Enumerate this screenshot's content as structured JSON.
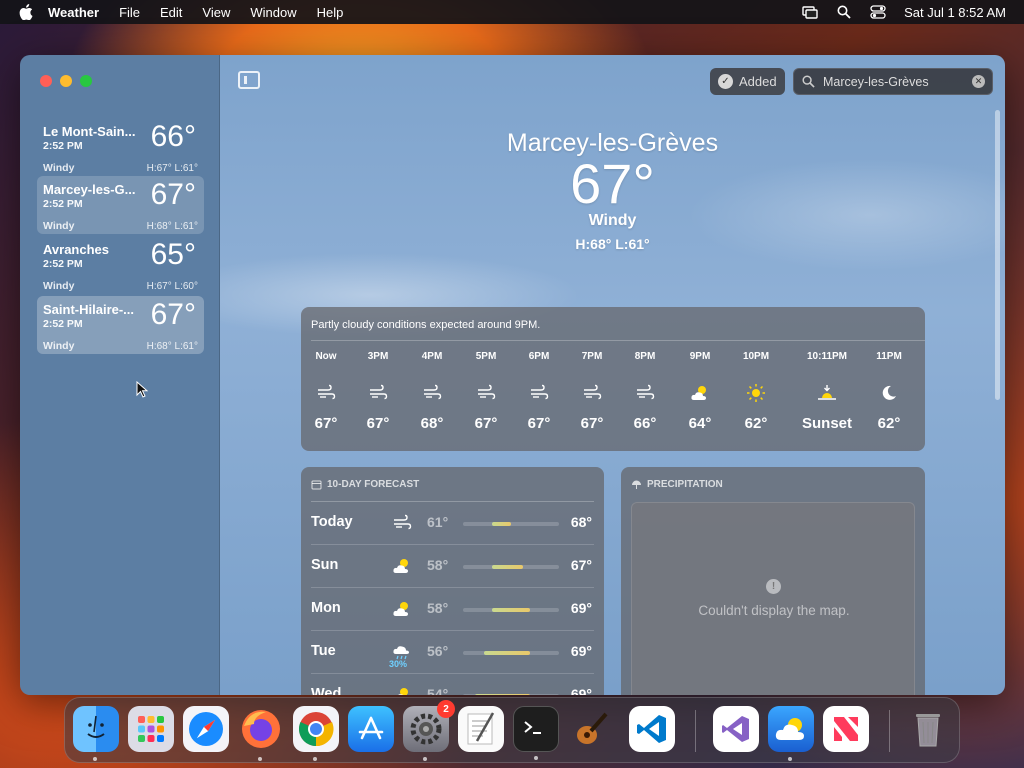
{
  "menubar": {
    "app_name": "Weather",
    "items": [
      "File",
      "Edit",
      "View",
      "Window",
      "Help"
    ],
    "datetime": "Sat Jul 1  8:52 AM"
  },
  "sidebar": {
    "locations": [
      {
        "name": "Le Mont-Sain...",
        "time": "2:52 PM",
        "temp": "66°",
        "condition": "Windy",
        "hl": "H:67°  L:61°"
      },
      {
        "name": "Marcey-les-G...",
        "time": "2:52 PM",
        "temp": "67°",
        "condition": "Windy",
        "hl": "H:68°  L:61°"
      },
      {
        "name": "Avranches",
        "time": "2:52 PM",
        "temp": "65°",
        "condition": "Windy",
        "hl": "H:67°  L:60°"
      },
      {
        "name": "Saint-Hilaire-...",
        "time": "2:52 PM",
        "temp": "67°",
        "condition": "Windy",
        "hl": "H:68°  L:61°"
      }
    ]
  },
  "toolbar": {
    "added_label": "Added",
    "search_value": "Marcey-les-Grèves"
  },
  "current": {
    "city": "Marcey-les-Grèves",
    "temp": "67°",
    "condition": "Windy",
    "hl": "H:68°  L:61°"
  },
  "hourly": {
    "summary": "Partly cloudy conditions expected around 9PM.",
    "hours": [
      {
        "label": "Now",
        "icon": "wind-icon",
        "temp": "67°"
      },
      {
        "label": "3PM",
        "icon": "wind-icon",
        "temp": "67°"
      },
      {
        "label": "4PM",
        "icon": "wind-icon",
        "temp": "68°"
      },
      {
        "label": "5PM",
        "icon": "wind-icon",
        "temp": "67°"
      },
      {
        "label": "6PM",
        "icon": "wind-icon",
        "temp": "67°"
      },
      {
        "label": "7PM",
        "icon": "wind-icon",
        "temp": "67°"
      },
      {
        "label": "8PM",
        "icon": "wind-icon",
        "temp": "66°"
      },
      {
        "label": "9PM",
        "icon": "partly-cloudy-icon",
        "temp": "64°"
      },
      {
        "label": "10PM",
        "icon": "sun-icon",
        "temp": "62°"
      },
      {
        "label": "10:11PM",
        "icon": "sunset-icon",
        "temp": "Sunset"
      },
      {
        "label": "11PM",
        "icon": "moon-icon",
        "temp": "62°"
      }
    ]
  },
  "forecast": {
    "title": "10-DAY FORECAST",
    "days": [
      {
        "day": "Today",
        "icon": "wind-icon",
        "prob": "",
        "lo": "61°",
        "hi": "68°"
      },
      {
        "day": "Sun",
        "icon": "partly-cloudy-icon",
        "prob": "",
        "lo": "58°",
        "hi": "67°"
      },
      {
        "day": "Mon",
        "icon": "partly-cloudy-icon",
        "prob": "",
        "lo": "58°",
        "hi": "69°"
      },
      {
        "day": "Tue",
        "icon": "rain-cloud-icon",
        "prob": "30%",
        "lo": "56°",
        "hi": "69°"
      },
      {
        "day": "Wed",
        "icon": "partly-cloudy-icon",
        "prob": "",
        "lo": "54°",
        "hi": "69°"
      }
    ]
  },
  "precipitation": {
    "title": "PRECIPITATION",
    "message": "Couldn't display the map."
  },
  "dock": {
    "badge_settings": "2"
  },
  "colors": {
    "accent_temp_bar": "#e9c86a",
    "precip_prob": "#6fd0ff"
  }
}
